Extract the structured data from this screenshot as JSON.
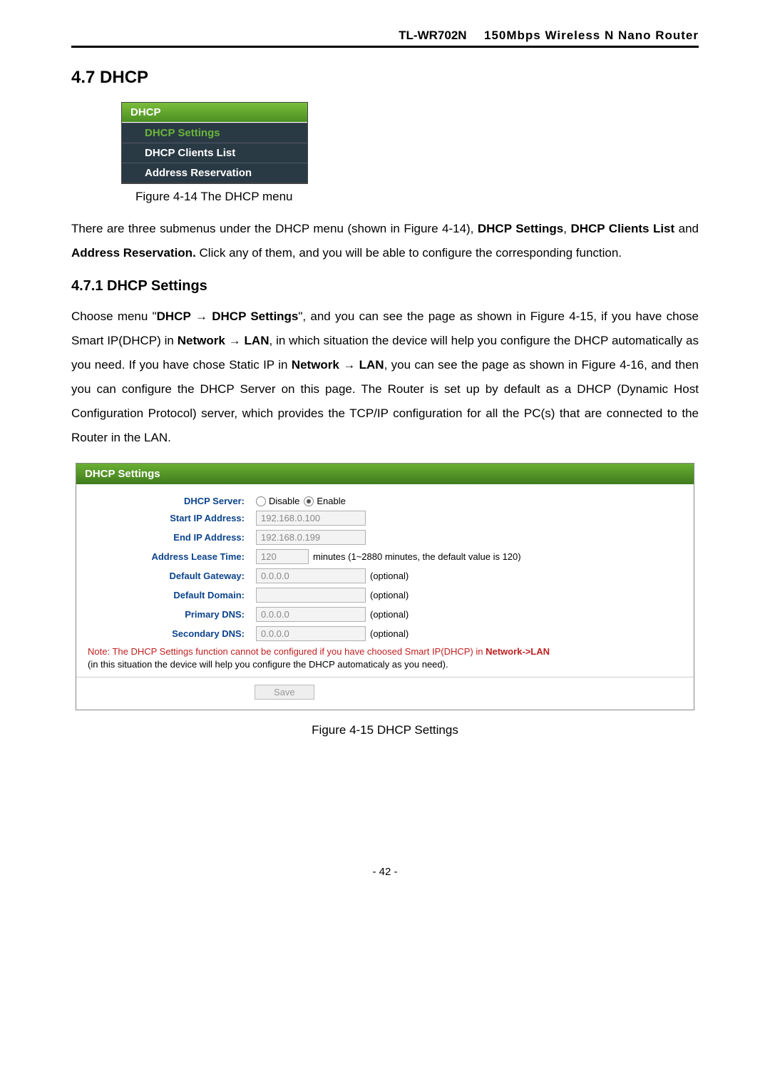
{
  "header": {
    "model": "TL-WR702N",
    "product": "150Mbps Wireless N Nano Router"
  },
  "section_heading": "4.7  DHCP",
  "menu": {
    "title": "DHCP",
    "items": [
      "DHCP Settings",
      "DHCP Clients List",
      "Address Reservation"
    ]
  },
  "fig1_caption": "Figure 4-14    The DHCP menu",
  "para1_a": "There are three submenus under the DHCP menu (shown in Figure 4-14), ",
  "para1_b": "DHCP Settings",
  "para1_c": ", ",
  "para1_d": "DHCP Clients List",
  "para1_e": " and ",
  "para1_f": "Address Reservation.",
  "para1_g": " Click any of them, and you will be able to configure the corresponding function.",
  "subsection_heading": "4.7.1    DHCP Settings",
  "para2_a": "Choose menu \"",
  "para2_b": "DHCP",
  "para2_c": "  →  ",
  "para2_d": "DHCP Settings",
  "para2_e": "\", and you can see the page as shown in Figure 4-15, if you have chose Smart IP(DHCP) in ",
  "para2_f": "Network",
  "para2_g": "  →  ",
  "para2_h": "LAN",
  "para2_i": ", in which situation the device will help you configure the DHCP automatically as you need. If you have chose Static IP in ",
  "para2_j": "Network",
  "para2_k": "  →  ",
  "para2_l": "LAN",
  "para2_m": ", you can see the page as shown in Figure 4-16, and then you can configure the DHCP Server on this page. The Router is set up by default as a DHCP (Dynamic Host Configuration Protocol) server, which provides the TCP/IP configuration for all the PC(s) that are connected to the Router in the LAN.",
  "panel": {
    "title": "DHCP Settings",
    "labels": {
      "server": "DHCP Server:",
      "start": "Start IP Address:",
      "end": "End IP Address:",
      "lease": "Address Lease Time:",
      "gateway": "Default Gateway:",
      "domain": "Default Domain:",
      "pdns": "Primary DNS:",
      "sdns": "Secondary DNS:"
    },
    "radio_disable": "Disable",
    "radio_enable": "Enable",
    "values": {
      "start": "192.168.0.100",
      "end": "192.168.0.199",
      "lease": "120",
      "gateway": "0.0.0.0",
      "domain": "",
      "pdns": "0.0.0.0",
      "sdns": "0.0.0.0"
    },
    "hints": {
      "lease": "minutes (1~2880 minutes, the default value is 120)",
      "optional": "(optional)"
    },
    "note_a": "Note: The DHCP Settings function cannot be configured if you have choosed Smart IP(DHCP) in ",
    "note_b": "Network->LAN",
    "note_c": " (in this situation the device will help you configure the DHCP automaticaly as you need).",
    "save": "Save"
  },
  "fig2_caption": "Figure 4-15 DHCP Settings",
  "page_number": "- 42 -"
}
